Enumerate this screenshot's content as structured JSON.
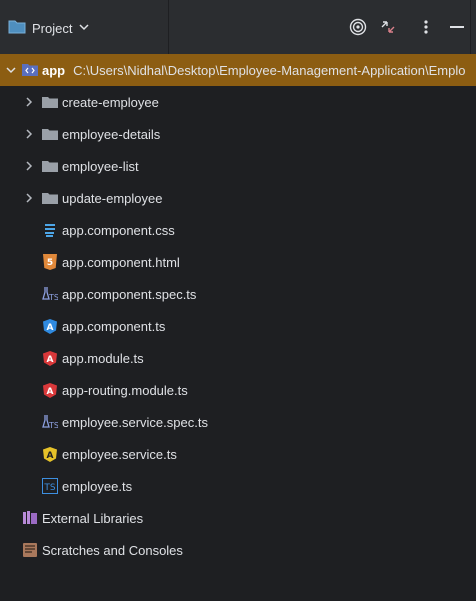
{
  "header": {
    "title": "Project",
    "icons": [
      "project-folder-icon",
      "chevron-down-icon",
      "target-icon",
      "collapse-icon",
      "more-icon"
    ]
  },
  "tree": {
    "root": {
      "name": "app",
      "path": "C:\\Users\\Nidhal\\Desktop\\Employee-Management-Application\\Emplo"
    },
    "folders": [
      "create-employee",
      "employee-details",
      "employee-list",
      "update-employee"
    ],
    "files": [
      {
        "name": "app.component.css",
        "icon": "css-icon"
      },
      {
        "name": "app.component.html",
        "icon": "html-icon"
      },
      {
        "name": "app.component.spec.ts",
        "icon": "spec-icon"
      },
      {
        "name": "app.component.ts",
        "icon": "angular-component-icon"
      },
      {
        "name": "app.module.ts",
        "icon": "angular-module-icon"
      },
      {
        "name": "app-routing.module.ts",
        "icon": "angular-module-icon"
      },
      {
        "name": "employee.service.spec.ts",
        "icon": "spec-icon"
      },
      {
        "name": "employee.service.ts",
        "icon": "angular-service-icon"
      },
      {
        "name": "employee.ts",
        "icon": "typescript-icon"
      }
    ],
    "extras": [
      "External Libraries",
      "Scratches and Consoles"
    ]
  },
  "colors": {
    "selected": "#8c5d12",
    "background": "#1e1f22",
    "header": "#2b2d30"
  }
}
